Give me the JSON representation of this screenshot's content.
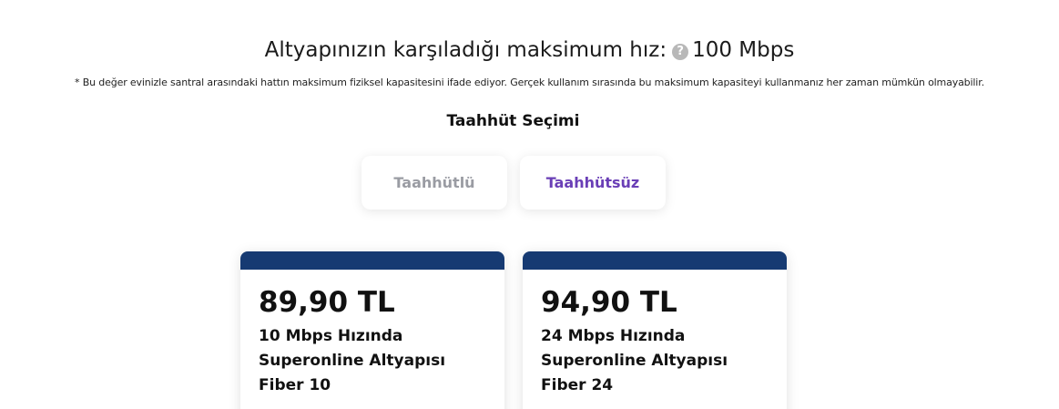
{
  "headline": {
    "text": "Altyapınızın karşıladığı maksimum hız:",
    "help_icon": "question-circle-icon",
    "speed": "100 Mbps"
  },
  "footnote": "* Bu değer evinizle santral arasındaki hattın maksimum fiziksel kapasitesini ifade ediyor. Gerçek kullanım sırasında bu maksimum kapasiteyi kullanmanız her zaman mümkün olmayabilir.",
  "commitment": {
    "title": "Taahhüt Seçimi",
    "options": [
      {
        "label": "Taahhütlü",
        "selected": false
      },
      {
        "label": "Taahhütsüz",
        "selected": true
      }
    ]
  },
  "colors": {
    "accent": "#6a3fb6",
    "card_band": "#163a72",
    "inactive": "#9a9ca3"
  },
  "plans": [
    {
      "price": "89,90 TL",
      "line1": "10 Mbps Hızında",
      "line2": "Superonline Altyapısı",
      "line3": "Fiber 10"
    },
    {
      "price": "94,90 TL",
      "line1": "24 Mbps Hızında",
      "line2": "Superonline Altyapısı",
      "line3": "Fiber 24"
    }
  ]
}
